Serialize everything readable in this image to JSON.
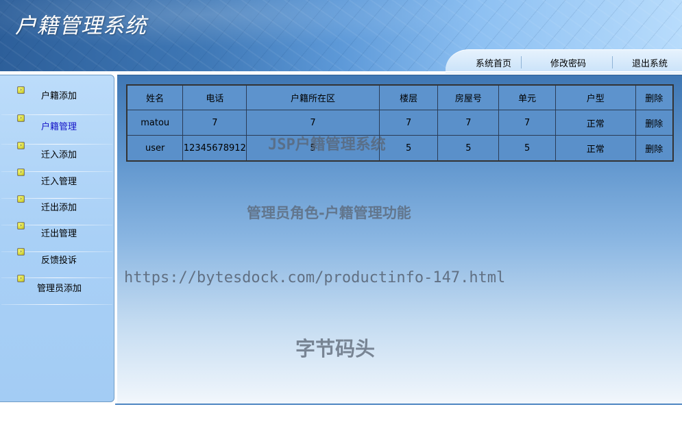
{
  "header": {
    "title": "户籍管理系统",
    "nav": [
      {
        "label": "系统首页"
      },
      {
        "label": "修改密码"
      },
      {
        "label": "退出系统"
      }
    ]
  },
  "sidebar": {
    "items": [
      {
        "label": "户籍添加",
        "active": false
      },
      {
        "label": "户籍管理",
        "active": true
      },
      {
        "label": "迁入添加",
        "active": false
      },
      {
        "label": "迁入管理",
        "active": false
      },
      {
        "label": "迁出添加",
        "active": false
      },
      {
        "label": "迁出管理",
        "active": false
      },
      {
        "label": "反馈投诉",
        "active": false
      },
      {
        "label": "管理员添加",
        "active": false
      }
    ]
  },
  "table": {
    "headers": [
      "姓名",
      "电话",
      "户籍所在区",
      "楼层",
      "房屋号",
      "单元",
      "户型",
      "删除"
    ],
    "rows": [
      [
        "matou",
        "7",
        "7",
        "7",
        "7",
        "7",
        "正常",
        "删除"
      ],
      [
        "user",
        "12345678912",
        "5",
        "5",
        "5",
        "5",
        "正常",
        "删除"
      ]
    ]
  },
  "watermarks": {
    "line1": "JSP户籍管理系统",
    "line2": "管理员角色-户籍管理功能",
    "line3": "https://bytesdock.com/productinfo-147.html",
    "line4": "字节码头"
  },
  "colors": {
    "active_link": "#1414c8",
    "table_header_bg": "#5d93cd",
    "table_cell_bg": "#5a90ca"
  }
}
